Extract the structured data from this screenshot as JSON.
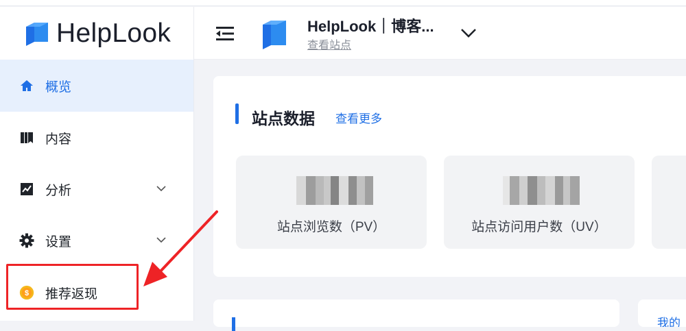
{
  "app": {
    "logo_text": "HelpLook"
  },
  "sidebar": {
    "items": [
      {
        "label": "概览",
        "icon": "home-icon",
        "active": true
      },
      {
        "label": "内容",
        "icon": "book-icon"
      },
      {
        "label": "分析",
        "icon": "chart-icon",
        "expandable": true
      },
      {
        "label": "设置",
        "icon": "gear-icon",
        "expandable": true
      },
      {
        "label": "推荐返现",
        "icon": "coin-icon"
      }
    ]
  },
  "header": {
    "site_title": "HelpLook｜博客...",
    "site_link": "查看站点"
  },
  "stats_card": {
    "title": "站点数据",
    "view_more": "查看更多",
    "stats": [
      {
        "label": "站点浏览数（PV）",
        "value": ""
      },
      {
        "label": "站点访问用户数（UV）",
        "value": ""
      }
    ]
  },
  "bottom": {
    "partial_text": "我的"
  },
  "colors": {
    "accent": "#1f6fe5",
    "active_bg": "#e7f0fd",
    "highlight": "#ee2326",
    "coin": "#f5b81c"
  }
}
